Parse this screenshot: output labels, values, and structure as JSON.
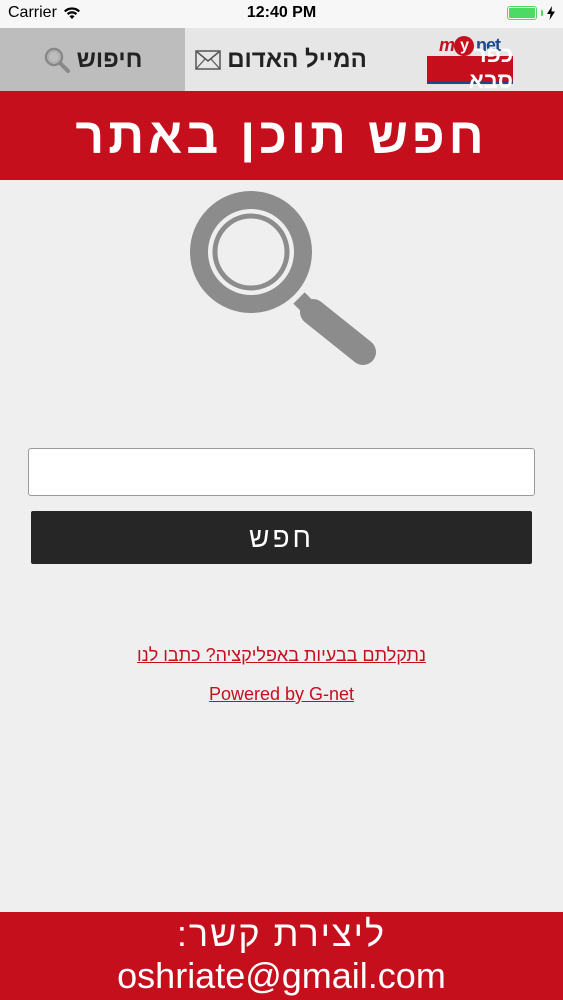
{
  "status_bar": {
    "carrier": "Carrier",
    "time": "12:40 PM"
  },
  "nav": {
    "search_tab_label": "חיפוש",
    "mail_tab_label": "המייל האדום",
    "logo_top_my": "m",
    "logo_top_y": "y",
    "logo_top_net": "net",
    "logo_bottom": "כפר סבא"
  },
  "page": {
    "title": "חפש תוכן באתר"
  },
  "search": {
    "input_value": "",
    "button_label": "חפש"
  },
  "links": {
    "problems": "נתקלתם בבעיות באפליקציה? כתבו לנו",
    "powered_by": "Powered by G-net"
  },
  "footer": {
    "contact_label": "ליצירת קשר:",
    "email": "oshriate@gmail.com"
  },
  "colors": {
    "brand_red": "#c50f1d",
    "button_dark": "#262626",
    "battery_green": "#4cd964"
  }
}
